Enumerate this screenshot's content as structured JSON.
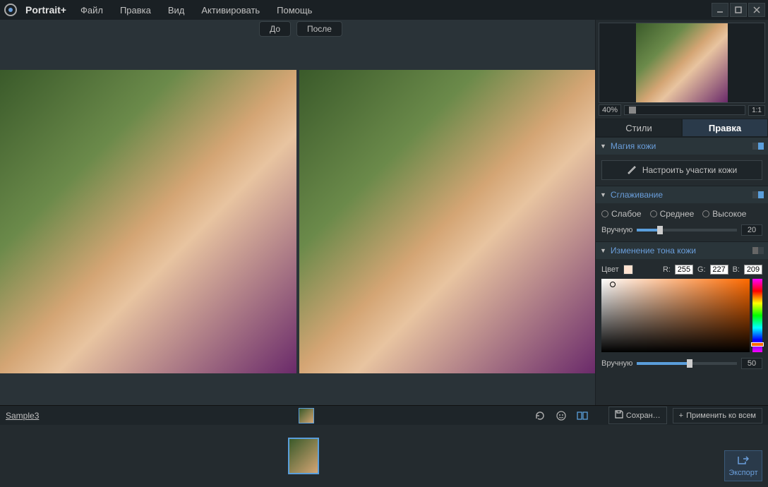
{
  "app": {
    "name": "Portrait+"
  },
  "menu": [
    "Файл",
    "Правка",
    "Вид",
    "Активировать",
    "Помощь"
  ],
  "viewer": {
    "before": "До",
    "after": "После"
  },
  "nav": {
    "zoom": "40%",
    "one_to_one": "1:1"
  },
  "tabs": {
    "styles": "Стили",
    "edit": "Правка"
  },
  "skin_magic": {
    "title": "Магия кожи",
    "configure_btn": "Настроить участки кожи"
  },
  "smoothing": {
    "title": "Сглаживание",
    "weak": "Слабое",
    "medium": "Среднее",
    "high": "Высокое",
    "manual": "Вручную",
    "value": "20"
  },
  "skin_tone": {
    "title": "Изменение тона кожи",
    "color_lbl": "Цвет",
    "r_lbl": "R:",
    "g_lbl": "G:",
    "b_lbl": "B:",
    "r": "255",
    "g": "227",
    "b": "209",
    "manual": "Вручную",
    "value": "50"
  },
  "footer": {
    "filename": "Sample3",
    "save": "Сохран…",
    "apply_all": "Применить ко всем",
    "export": "Экспорт"
  }
}
